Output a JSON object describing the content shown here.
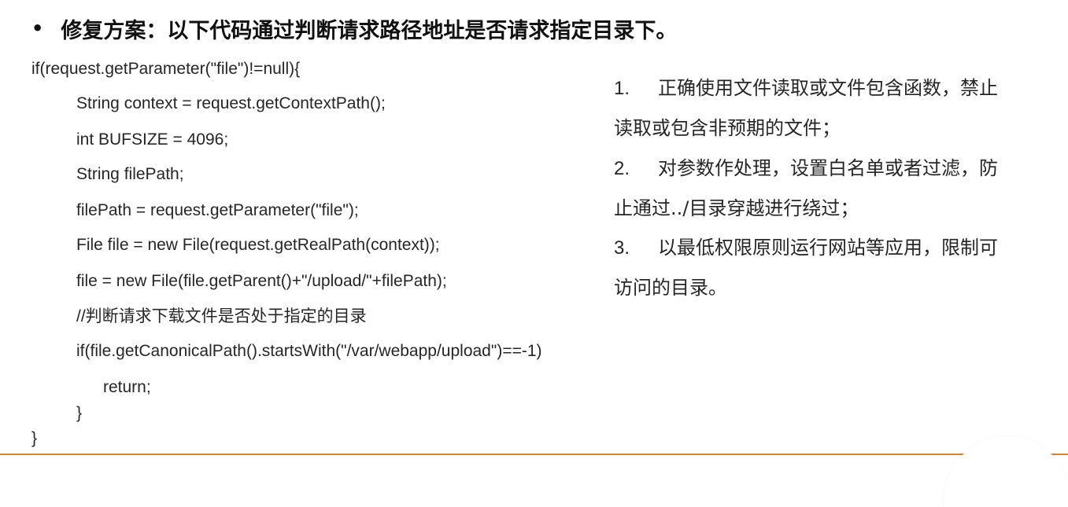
{
  "heading": {
    "bullet": "•",
    "text": "修复方案：以下代码通过判断请求路径地址是否请求指定目录下。"
  },
  "code": [
    "if(request.getParameter(\"file\")!=null){",
    "String context = request.getContextPath();",
    "int BUFSIZE = 4096;",
    "String filePath;",
    "filePath = request.getParameter(\"file\");",
    "File file = new File(request.getRealPath(context));",
    "file = new File(file.getParent()+\"/upload/\"+filePath);",
    "//判断请求下载文件是否处于指定的目录",
    "if(file.getCanonicalPath().startsWith(\"/var/webapp/upload\")==-1)",
    "return;",
    "}",
    "}"
  ],
  "notes": [
    {
      "number": "1.",
      "line1": "正确使用文件读取或文件包含函数，禁止",
      "line2": "读取或包含非预期的文件；"
    },
    {
      "number": "2.",
      "line1": "对参数作处理，设置白名单或者过滤，防",
      "line2": "止通过../目录穿越进行绕过；"
    },
    {
      "number": "3.",
      "line1": "以最低权限原则运行网站等应用，限制可",
      "line2": "访问的目录。"
    }
  ],
  "colors": {
    "accent_rule": "#c7893e",
    "text": "#262626"
  }
}
